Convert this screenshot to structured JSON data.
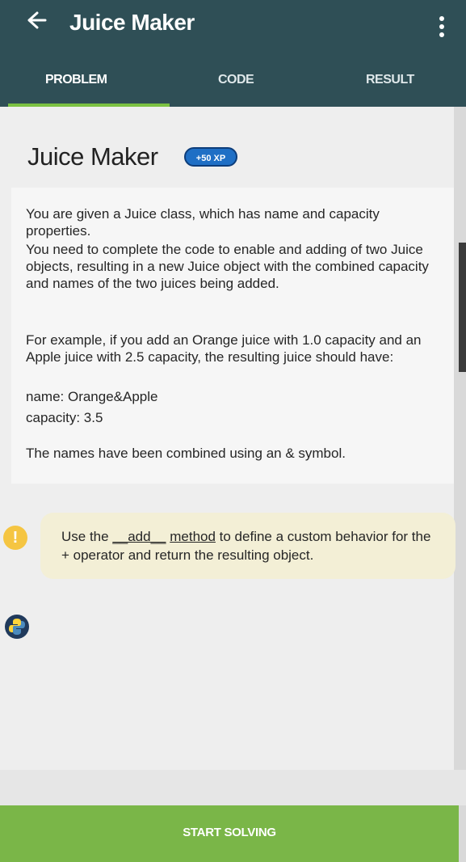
{
  "appbar": {
    "title": "Juice Maker",
    "back_icon": "arrow-left-icon",
    "menu_icon": "more-vertical-icon",
    "tabs": [
      {
        "label": "PROBLEM",
        "active": true
      },
      {
        "label": "CODE",
        "active": false
      },
      {
        "label": "RESULT",
        "active": false
      }
    ]
  },
  "card": {
    "title": "Juice Maker",
    "xp_badge": "+50 XP",
    "paragraphs": [
      "You are given a Juice class, which has name and capacity properties.",
      "You need to complete the code to enable and adding of two Juice objects, resulting in a new Juice object with the combined capacity and names of the two juices being added.",
      "For example, if you add an Orange juice with 1.0 capacity and an Apple juice with 2.5 capacity, the resulting juice should have:",
      "name: Orange&Apple",
      "capacity: 3.5",
      "The names have been combined using an & symbol."
    ]
  },
  "tip": {
    "prefix": "Use the ",
    "method": "__add__",
    "link": "method",
    "suffix": " to define a custom behavior for the + operator and return the resulting object.",
    "icon": "warning-icon"
  },
  "python_icon": "python-icon",
  "start_button": "START SOLVING",
  "colors": {
    "appbar": "#2f4f56",
    "accent_green": "#7ab648",
    "xp_badge": "#1f6fc5",
    "tip_bg": "#f3efd6"
  }
}
